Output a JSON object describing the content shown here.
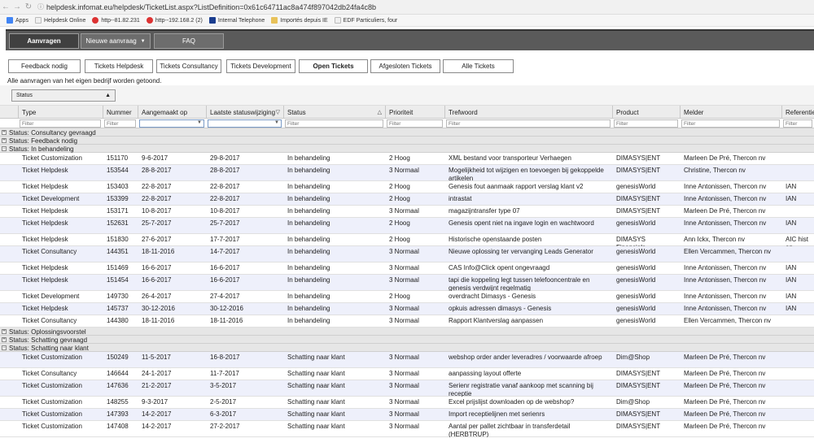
{
  "browser": {
    "url": "helpdesk.infomat.eu/helpdesk/TicketList.aspx?ListDefinition=0x61c64711ac8a474f897042db24fa4c8b",
    "bookmarks": [
      "Apps",
      "Helpdesk Online",
      "http--81.82.231",
      "http--192.168.2 (2)",
      "Internal Telephone",
      "Importés depuis IE",
      "EDF Particuliers, four"
    ]
  },
  "nav": {
    "items": [
      "Aanvragen",
      "Nieuwe aanvraag",
      "FAQ"
    ]
  },
  "tabs": [
    "Feedback nodig",
    "Tickets Helpdesk",
    "Tickets Consultancy",
    "Tickets Development",
    "Open Tickets",
    "Afgesloten Tickets",
    "Alle Tickets"
  ],
  "info_text": "Alle aanvragen van het eigen bedrijf worden getoond.",
  "group_panel": {
    "chip": "Status"
  },
  "grid": {
    "columns": [
      "Type",
      "Nummer",
      "Aangemaakt op",
      "Laatste statuswijziging",
      "Status",
      "Prioriteit",
      "Trefwoord",
      "Product",
      "Melder",
      "Referentie"
    ],
    "filter_placeholder": "Filter",
    "rows": [
      {
        "kind": "group",
        "label": "Status: Consultancy gevraagd",
        "toggle": "+"
      },
      {
        "kind": "group",
        "label": "Status: Feedback nodig",
        "toggle": "+"
      },
      {
        "kind": "group",
        "label": "Status: In behandeling",
        "toggle": "−"
      },
      {
        "kind": "data",
        "cells": [
          "Ticket Customization",
          "151170",
          "9-6-2017",
          "29-8-2017",
          "In behandeling",
          "2 Hoog",
          "XML bestand voor transporteur Verhaegen",
          "DIMASYS|ENT",
          "Marleen De Pré, Thercon nv",
          ""
        ]
      },
      {
        "kind": "data",
        "cells": [
          "Ticket Helpdesk",
          "153544",
          "28-8-2017",
          "28-8-2017",
          "In behandeling",
          "3 Normaal",
          "Mogelijkheid tot wijzigen en toevoegen bij gekoppelde artikelen",
          "DIMASYS|ENT",
          "Christine, Thercon nv",
          ""
        ]
      },
      {
        "kind": "data",
        "cells": [
          "Ticket Helpdesk",
          "153403",
          "22-8-2017",
          "22-8-2017",
          "In behandeling",
          "2 Hoog",
          "Genesis fout aanmaak rapport verslag klant v2",
          "genesisWorld",
          "Inne Antonissen, Thercon nv",
          "IAN"
        ]
      },
      {
        "kind": "data",
        "cells": [
          "Ticket Development",
          "153399",
          "22-8-2017",
          "22-8-2017",
          "In behandeling",
          "2 Hoog",
          "intrastat",
          "DIMASYS|ENT",
          "Inne Antonissen, Thercon nv",
          "IAN"
        ]
      },
      {
        "kind": "data",
        "cells": [
          "Ticket Helpdesk",
          "153171",
          "10-8-2017",
          "10-8-2017",
          "In behandeling",
          "3 Normaal",
          "magazijntransfer type 07",
          "DIMASYS|ENT",
          "Marleen De Pré, Thercon nv",
          ""
        ]
      },
      {
        "kind": "data",
        "cells": [
          "Ticket Helpdesk",
          "152631",
          "25-7-2017",
          "25-7-2017",
          "In behandeling",
          "2 Hoog",
          "Genesis opent niet na ingave login en wachtwoord",
          "genesisWorld",
          "Inne Antonissen, Thercon nv",
          "IAN"
        ]
      },
      {
        "kind": "data",
        "cells": [
          "Ticket Helpdesk",
          "151830",
          "27-6-2017",
          "17-7-2017",
          "In behandeling",
          "2 Hoog",
          "Historische openstaande posten",
          "DIMASYS Financials",
          "Ann Ickx, Thercon nv",
          "AIC hist op"
        ]
      },
      {
        "kind": "data",
        "cells": [
          "Ticket Consultancy",
          "144351",
          "18-11-2016",
          "14-7-2017",
          "In behandeling",
          "3 Normaal",
          "Nieuwe oplossing ter vervanging Leads Generator",
          "genesisWorld",
          "Ellen Vercammen, Thercon nv",
          ""
        ]
      },
      {
        "kind": "data",
        "cells": [
          "Ticket Helpdesk",
          "151469",
          "16-6-2017",
          "16-6-2017",
          "In behandeling",
          "3 Normaal",
          "CAS Info@Click opent ongevraagd",
          "genesisWorld",
          "Inne Antonissen, Thercon nv",
          "IAN"
        ]
      },
      {
        "kind": "data",
        "cells": [
          "Ticket Helpdesk",
          "151454",
          "16-6-2017",
          "16-6-2017",
          "In behandeling",
          "3 Normaal",
          "tapi die koppeling legt tussen telefooncentrale en genesis verdwijnt regelmatig",
          "genesisWorld",
          "Inne Antonissen, Thercon nv",
          "IAN"
        ]
      },
      {
        "kind": "data",
        "cells": [
          "Ticket Development",
          "149730",
          "26-4-2017",
          "27-4-2017",
          "In behandeling",
          "2 Hoog",
          "overdracht Dimasys - Genesis",
          "genesisWorld",
          "Inne Antonissen, Thercon nv",
          "IAN"
        ]
      },
      {
        "kind": "data",
        "cells": [
          "Ticket Helpdesk",
          "145737",
          "30-12-2016",
          "30-12-2016",
          "In behandeling",
          "3 Normaal",
          "opkuis adressen dimasys - Genesis",
          "genesisWorld",
          "Inne Antonissen, Thercon nv",
          "IAN"
        ]
      },
      {
        "kind": "data",
        "cells": [
          "Ticket Consultancy",
          "144380",
          "18-11-2016",
          "18-11-2016",
          "In behandeling",
          "3 Normaal",
          "Rapport Klantverslag aanpassen",
          "genesisWorld",
          "Ellen Vercammen, Thercon nv",
          ""
        ]
      },
      {
        "kind": "group",
        "label": "Status: Oplossingsvoorstel",
        "toggle": "+"
      },
      {
        "kind": "group",
        "label": "Status: Schatting gevraagd",
        "toggle": "+"
      },
      {
        "kind": "group",
        "label": "Status: Schatting naar klant",
        "toggle": "−"
      },
      {
        "kind": "data",
        "cells": [
          "Ticket Customization",
          "150249",
          "11-5-2017",
          "16-8-2017",
          "Schatting naar klant",
          "3 Normaal",
          "webshop order ander leveradres / voorwaarde afroep",
          "Dim@Shop",
          "Marleen De Pré, Thercon nv",
          ""
        ]
      },
      {
        "kind": "data",
        "cells": [
          "Ticket Consultancy",
          "146644",
          "24-1-2017",
          "11-7-2017",
          "Schatting naar klant",
          "3 Normaal",
          "aanpassing layout offerte",
          "DIMASYS|ENT",
          "Marleen De Pré, Thercon nv",
          ""
        ]
      },
      {
        "kind": "data",
        "cells": [
          "Ticket Customization",
          "147636",
          "21-2-2017",
          "3-5-2017",
          "Schatting naar klant",
          "3 Normaal",
          "Serienr registratie vanaf aankoop met scanning bij receptie",
          "DIMASYS|ENT",
          "Marleen De Pré, Thercon nv",
          ""
        ]
      },
      {
        "kind": "data",
        "cells": [
          "Ticket Customization",
          "148255",
          "9-3-2017",
          "2-5-2017",
          "Schatting naar klant",
          "3 Normaal",
          "Excel prijslijst downloaden op de webshop?",
          "Dim@Shop",
          "Marleen De Pré, Thercon nv",
          ""
        ]
      },
      {
        "kind": "data",
        "cells": [
          "Ticket Customization",
          "147393",
          "14-2-2017",
          "6-3-2017",
          "Schatting naar klant",
          "3 Normaal",
          "Import receptielijnen met serienrs",
          "DIMASYS|ENT",
          "Marleen De Pré, Thercon nv",
          ""
        ]
      },
      {
        "kind": "data",
        "cells": [
          "Ticket Customization",
          "147408",
          "14-2-2017",
          "27-2-2017",
          "Schatting naar klant",
          "3 Normaal",
          "Aantal per pallet zichtbaar in transferdetail (HERBTRUP)",
          "DIMASYS|ENT",
          "Marleen De Pré, Thercon nv",
          ""
        ]
      }
    ]
  },
  "colors": {
    "nav_bg": "#5a5a5a",
    "row_alt": "#eef0fb",
    "group_bg": "#e6e6e6"
  }
}
